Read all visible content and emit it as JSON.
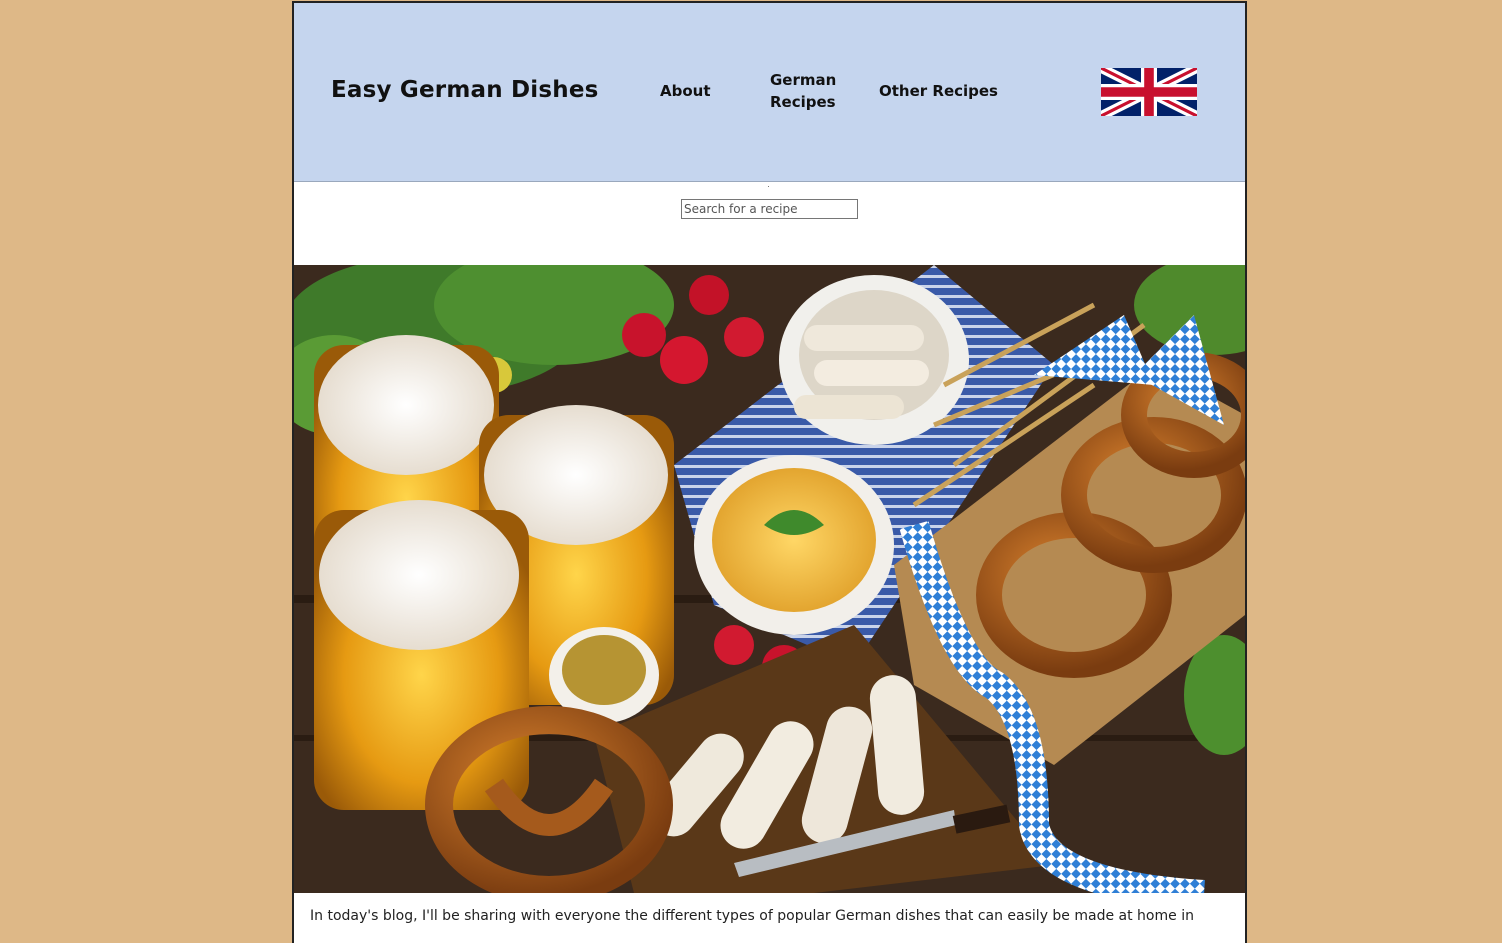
{
  "header": {
    "site_title": "Easy German Dishes",
    "nav": [
      {
        "label": "About"
      },
      {
        "label": "German Recipes"
      },
      {
        "label": "Other Recipes"
      }
    ],
    "language_flag": "uk-flag-icon"
  },
  "search": {
    "placeholder": "Search for a recipe",
    "value": ""
  },
  "hero": {
    "image": "bavarian-food-spread-image"
  },
  "content": {
    "intro": "In today's blog, I'll be sharing with everyone the different types of popular German dishes that can easily be made at home in"
  },
  "colors": {
    "background": "#deb887",
    "header": "#c5d5ee",
    "text": "#111111"
  }
}
